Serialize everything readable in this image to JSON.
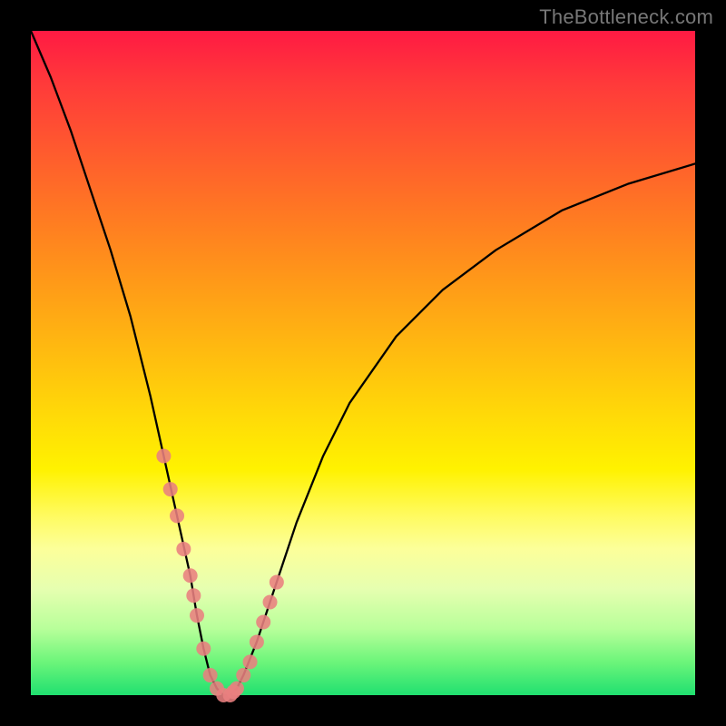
{
  "watermark": "TheBottleneck.com",
  "colors": {
    "frame": "#000000",
    "curve": "#000000",
    "marker": "#e98080",
    "gradient_top": "#ff1a43",
    "gradient_bottom": "#20e070"
  },
  "chart_data": {
    "type": "line",
    "title": "",
    "xlabel": "",
    "ylabel": "",
    "xlim": [
      0,
      100
    ],
    "ylim": [
      0,
      100
    ],
    "series": [
      {
        "name": "bottleneck-curve",
        "x": [
          0,
          3,
          6,
          9,
          12,
          15,
          18,
          20,
          22,
          24,
          25,
          26,
          27,
          28,
          29,
          30,
          31,
          32,
          34,
          36,
          38,
          40,
          44,
          48,
          55,
          62,
          70,
          80,
          90,
          100
        ],
        "y": [
          100,
          93,
          85,
          76,
          67,
          57,
          45,
          36,
          27,
          18,
          12,
          7,
          3,
          1,
          0,
          0,
          1,
          3,
          8,
          14,
          20,
          26,
          36,
          44,
          54,
          61,
          67,
          73,
          77,
          80
        ]
      }
    ],
    "markers": {
      "name": "highlighted-points",
      "x": [
        20,
        21,
        22,
        23,
        24,
        24.5,
        25,
        26,
        27,
        28,
        29,
        30,
        30.5,
        31,
        32,
        33,
        34,
        35,
        36,
        37
      ],
      "y": [
        36,
        31,
        27,
        22,
        18,
        15,
        12,
        7,
        3,
        1,
        0,
        0,
        0.5,
        1,
        3,
        5,
        8,
        11,
        14,
        17
      ]
    }
  }
}
